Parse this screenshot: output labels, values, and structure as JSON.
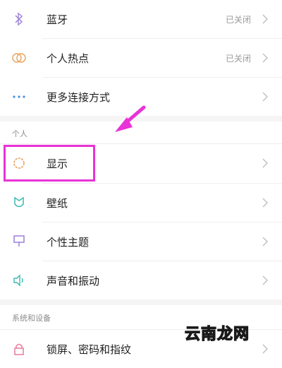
{
  "items": [
    {
      "label": "蓝牙",
      "value": "已关闭",
      "icon": "bluetooth-icon"
    },
    {
      "label": "个人热点",
      "value": "已关闭",
      "icon": "hotspot-icon"
    },
    {
      "label": "更多连接方式",
      "value": "",
      "icon": "more-dots-icon"
    },
    {
      "label": "显示",
      "value": "",
      "icon": "display-icon"
    },
    {
      "label": "壁纸",
      "value": "",
      "icon": "wallpaper-icon"
    },
    {
      "label": "个性主题",
      "value": "",
      "icon": "theme-icon"
    },
    {
      "label": "声音和振动",
      "value": "",
      "icon": "sound-icon"
    },
    {
      "label": "锁屏、密码和指纹",
      "value": "",
      "icon": "lock-icon"
    }
  ],
  "sections": {
    "personal": "个人",
    "system": "系统和设备"
  },
  "watermark": "云南龙网",
  "colors": {
    "annotation": "#e833d6",
    "accent_orange": "#e8a25a",
    "accent_purple": "#9b7fd6",
    "accent_teal": "#3bb9b0",
    "accent_blue": "#4a90d9"
  }
}
